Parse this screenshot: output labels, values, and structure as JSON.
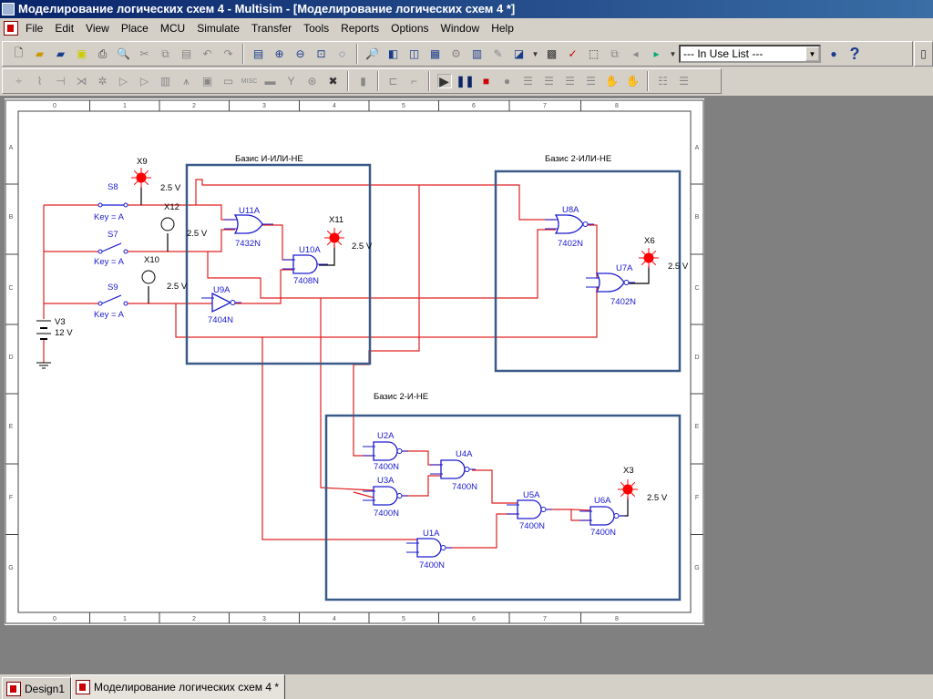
{
  "window": {
    "title": "Моделирование логических схем 4 - Multisim - [Моделирование логических схем 4 *]"
  },
  "menu": [
    "File",
    "Edit",
    "View",
    "Place",
    "MCU",
    "Simulate",
    "Transfer",
    "Tools",
    "Reports",
    "Options",
    "Window",
    "Help"
  ],
  "toolbar": {
    "in_use_list": "--- In Use List ---",
    "help_label": "?"
  },
  "colors": {
    "wire": "#e02020",
    "component": "#1a1ad0",
    "block_border": "#3a5a8a",
    "probe_on": "#ff0000"
  },
  "rulers": {
    "columns": [
      "0",
      "1",
      "2",
      "3",
      "4",
      "5",
      "6",
      "7",
      "8"
    ],
    "rows": [
      "A",
      "B",
      "C",
      "D",
      "E",
      "F",
      "G"
    ]
  },
  "schematic": {
    "blocks": [
      {
        "title": "Базис И-ИЛИ-НЕ"
      },
      {
        "title": "Базис 2-ИЛИ-НЕ"
      },
      {
        "title": "Базис 2-И-НЕ"
      }
    ],
    "switches": [
      {
        "name": "S8",
        "key": "Key = A"
      },
      {
        "name": "S7",
        "key": "Key = A"
      },
      {
        "name": "S9",
        "key": "Key = A"
      }
    ],
    "source": {
      "name": "V3",
      "value": "12 V"
    },
    "probes": [
      {
        "name": "X9",
        "voltage": "2.5 V",
        "state": "on"
      },
      {
        "name": "X12",
        "voltage": "2.5 V",
        "state": "off"
      },
      {
        "name": "X10",
        "voltage": "2.5 V",
        "state": "off"
      },
      {
        "name": "X11",
        "voltage": "2.5 V",
        "state": "on"
      },
      {
        "name": "X6",
        "voltage": "2.5 V",
        "state": "on"
      },
      {
        "name": "X3",
        "voltage": "2.5 V",
        "state": "on"
      }
    ],
    "gates": [
      {
        "ref": "U11A",
        "part": "7432N"
      },
      {
        "ref": "U10A",
        "part": "7408N"
      },
      {
        "ref": "U9A",
        "part": "7404N"
      },
      {
        "ref": "U8A",
        "part": "7402N"
      },
      {
        "ref": "U7A",
        "part": "7402N"
      },
      {
        "ref": "U2A",
        "part": "7400N"
      },
      {
        "ref": "U4A",
        "part": "7400N"
      },
      {
        "ref": "U3A",
        "part": "7400N"
      },
      {
        "ref": "U5A",
        "part": "7400N"
      },
      {
        "ref": "U6A",
        "part": "7400N"
      },
      {
        "ref": "U1A",
        "part": "7400N"
      }
    ]
  },
  "tabs": [
    {
      "label": "Design1",
      "active": false
    },
    {
      "label": "Моделирование логических схем 4 *",
      "active": true
    }
  ]
}
